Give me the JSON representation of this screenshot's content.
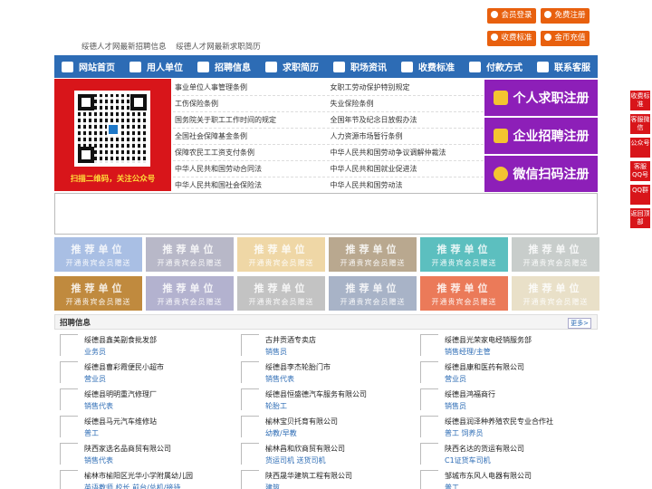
{
  "header": {
    "links": [
      "绥德人才网最新招聘信息",
      "绥德人才网最新求职简历"
    ],
    "buttons": [
      "会员登录",
      "免费注册",
      "收费标准",
      "金币充值"
    ]
  },
  "nav": {
    "items": [
      {
        "label": "网站首页",
        "icon": "home-icon"
      },
      {
        "label": "用人单位",
        "icon": "building-icon"
      },
      {
        "label": "招聘信息",
        "icon": "users-icon"
      },
      {
        "label": "求职简历",
        "icon": "document-icon"
      },
      {
        "label": "职场资讯",
        "icon": "news-icon"
      },
      {
        "label": "收费标准",
        "icon": "yen-icon"
      },
      {
        "label": "付款方式",
        "icon": "payment-icon"
      },
      {
        "label": "联系客服",
        "icon": "phone-icon"
      }
    ]
  },
  "qr": {
    "caption": "扫描二维码，关注公众号"
  },
  "laws": [
    [
      "事业单位人事管理条例",
      "女职工劳动保护特别规定"
    ],
    [
      "工伤保险条例",
      "失业保险条例"
    ],
    [
      "国务院关于职工工作时间的规定",
      "全国年节及纪念日放假办法"
    ],
    [
      "全国社会保障基金条例",
      "人力资源市场暂行条例"
    ],
    [
      "保障农民工工资支付条例",
      "中华人民共和国劳动争议调解仲裁法"
    ],
    [
      "中华人民共和国劳动合同法",
      "中华人民共和国就业促进法"
    ],
    [
      "中华人民共和国社会保险法",
      "中华人民共和国劳动法"
    ]
  ],
  "register": [
    "个人求职注册",
    "企业招聘注册",
    "微信扫码注册"
  ],
  "recommend": {
    "title": "推荐单位",
    "subtitle": "开通贵宾会员赠送",
    "colors": [
      "#a9bfe4",
      "#b8b8c8",
      "#efd7a6",
      "#b9a88f",
      "#5cbfbf",
      "#c8cdcb",
      "#c08a3e",
      "#b3b2cf",
      "#c3c3c3",
      "#a8b3c7",
      "#eb7a59",
      "#e9e0c8"
    ]
  },
  "jobs": {
    "title": "招聘信息",
    "more": "更多>",
    "items": [
      {
        "company": "绥德县鑫美副食批发部",
        "position": "业务员"
      },
      {
        "company": "古井贡酒专卖店",
        "position": "销售员"
      },
      {
        "company": "绥德县光荣家电经销服务部",
        "position": "销售经理/主管"
      },
      {
        "company": "绥德县曹彩霞便民小超市",
        "position": "营业员"
      },
      {
        "company": "绥德县李杰轮胎门市",
        "position": "销售代表"
      },
      {
        "company": "绥德县康和医药有限公司",
        "position": "营业员"
      },
      {
        "company": "绥德县明明重汽修理厂",
        "position": "销售代表"
      },
      {
        "company": "绥德县恒盛德汽车服务有限公司",
        "position": "轮胎工"
      },
      {
        "company": "绥德县鸿福商行",
        "position": "销售员"
      },
      {
        "company": "绥德县马元汽车维修站",
        "position": "普工"
      },
      {
        "company": "榆林宝贝托育有限公司",
        "position": "幼教/早教"
      },
      {
        "company": "绥德县润泽种养殖农民专业合作社",
        "position": "普工 饲养员"
      },
      {
        "company": "陕西家选名品商贸有限公司",
        "position": "销售代表"
      },
      {
        "company": "榆林昌和欣商贸有限公司",
        "position": "货运司机 送货司机"
      },
      {
        "company": "陕西名达的货运有限公司",
        "position": "C1证货车司机"
      },
      {
        "company": "榆林市榆阳区光华小学附属幼儿园",
        "position": "英语教师 校长 前台/总机/接待"
      },
      {
        "company": "陕西晟华建筑工程有限公司",
        "position": "建筑"
      },
      {
        "company": "邹城市东风人电器有限公司",
        "position": "普工"
      }
    ]
  },
  "float_bar": [
    "收费标准",
    "客服微信",
    "公众号",
    "客服QQ号",
    "QQ群",
    "返回顶部"
  ]
}
